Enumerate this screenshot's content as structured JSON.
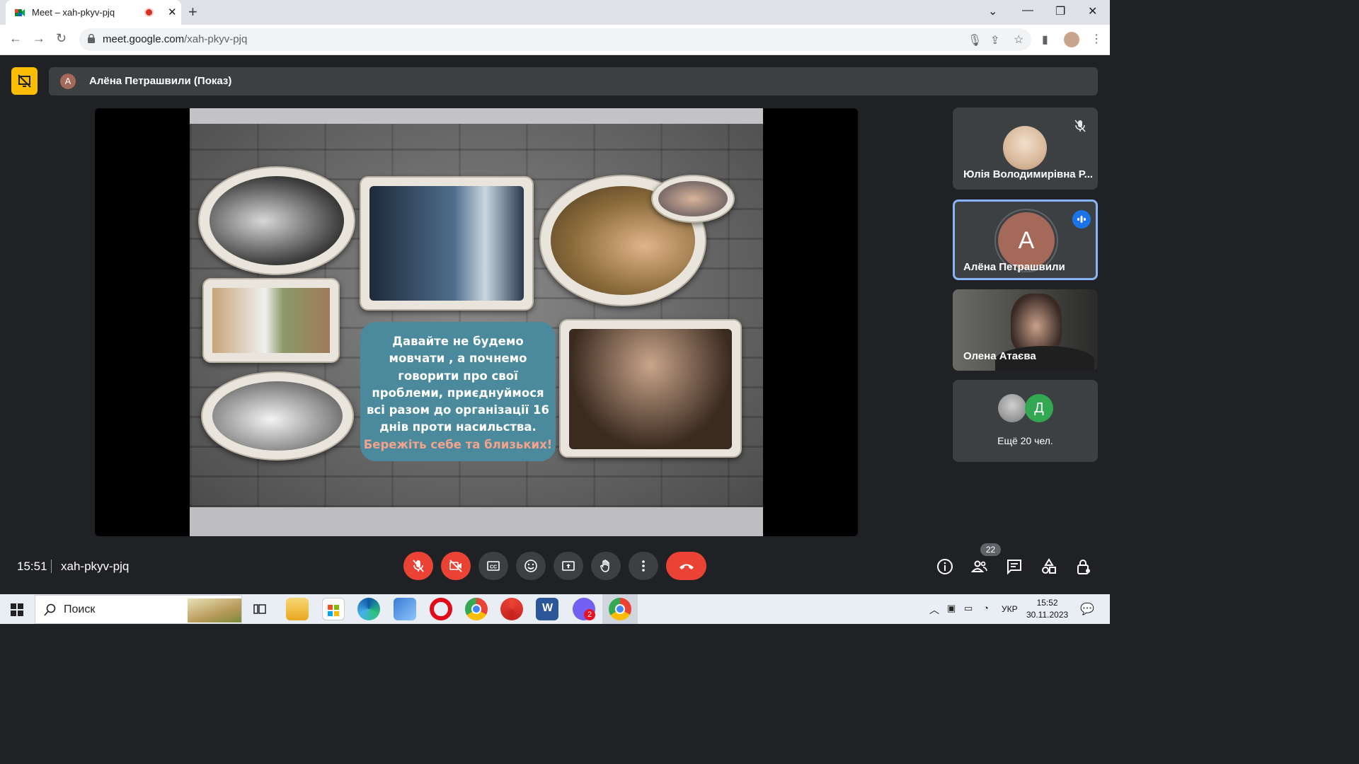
{
  "browser": {
    "tab_title": "Meet – xah-pkyv-pjq",
    "url_host": "meet.google.com",
    "url_path": "/xah-pkyv-pjq",
    "icons": [
      "back-icon",
      "forward-icon",
      "reload-icon",
      "lock-icon",
      "mic-icon",
      "share-icon",
      "star-icon",
      "sidepanel-icon",
      "menu-icon"
    ]
  },
  "meet": {
    "presenter_initial": "А",
    "presenter_label": "Алёна Петрашвили (Показ)",
    "slide": {
      "lines": [
        "Давайте не будемо",
        "мовчати , а почнемо",
        "говорити про свої",
        "проблеми, приєднуймося",
        "всі разом до організації 16",
        "днів проти насильства."
      ],
      "highlight": "Бережіть себе та близьких!"
    },
    "participants": [
      {
        "name": "Юлія Володимирівна Р...",
        "muted": true
      },
      {
        "name": "Алёна Петрашвили",
        "initial": "А",
        "speaking": true
      },
      {
        "name": "Олена Атаєва"
      },
      {
        "initial": "Д",
        "more_label": "Ещё 20 чел."
      }
    ],
    "time": "15:51",
    "code": "xah-pkyv-pjq",
    "people_count": "22"
  },
  "taskbar": {
    "search_placeholder": "Поиск",
    "lang": "УКР",
    "time": "15:52",
    "date": "30.11.2023",
    "viber_badge": "2"
  },
  "colors": {
    "accent": "#8ab4f8",
    "end_call": "#ea4335",
    "present": "#fbbc04",
    "bg": "#202124"
  }
}
